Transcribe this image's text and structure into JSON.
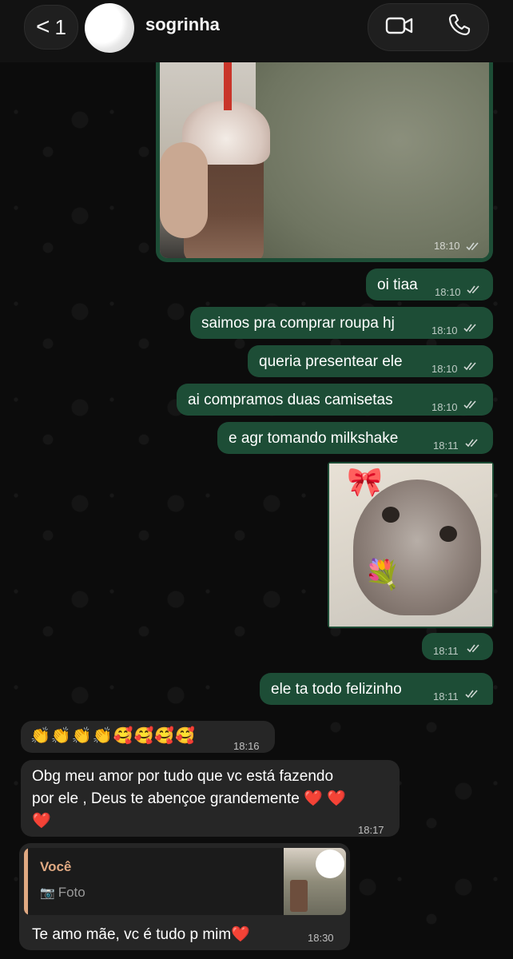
{
  "header": {
    "back_count": "1",
    "contact_name": "sogrinha"
  },
  "messages": {
    "img1_time": "18:10",
    "m1": {
      "text": "oi tiaa",
      "time": "18:10"
    },
    "m2": {
      "text": "saimos pra comprar roupa hj",
      "time": "18:10"
    },
    "m3": {
      "text": "queria presentear ele",
      "time": "18:10"
    },
    "m4": {
      "text": "ai compramos duas camisetas",
      "time": "18:10"
    },
    "m5": {
      "text": "e agr tomando milkshake",
      "time": "18:11"
    },
    "img2_time": "18:11",
    "m6": {
      "text": "ele ta todo felizinho",
      "time": "18:11"
    },
    "in1": {
      "text": "👏👏👏👏🥰🥰🥰🥰",
      "time": "18:16"
    },
    "in2": {
      "line1": "Obg meu amor por tudo que vc está fazendo",
      "line2": "por ele , Deus te abençoe grandemente ❤️ ❤️",
      "line3": "❤️",
      "time": "18:17"
    },
    "reply": {
      "author": "Você",
      "type_label": "Foto",
      "text": "Te amo mãe,  vc é  tudo p  mim❤️",
      "time": "18:30"
    }
  },
  "colors": {
    "outgoing_bubble": "#1d4d36",
    "incoming_bubble": "#262626",
    "reply_accent": "#e0a982"
  }
}
